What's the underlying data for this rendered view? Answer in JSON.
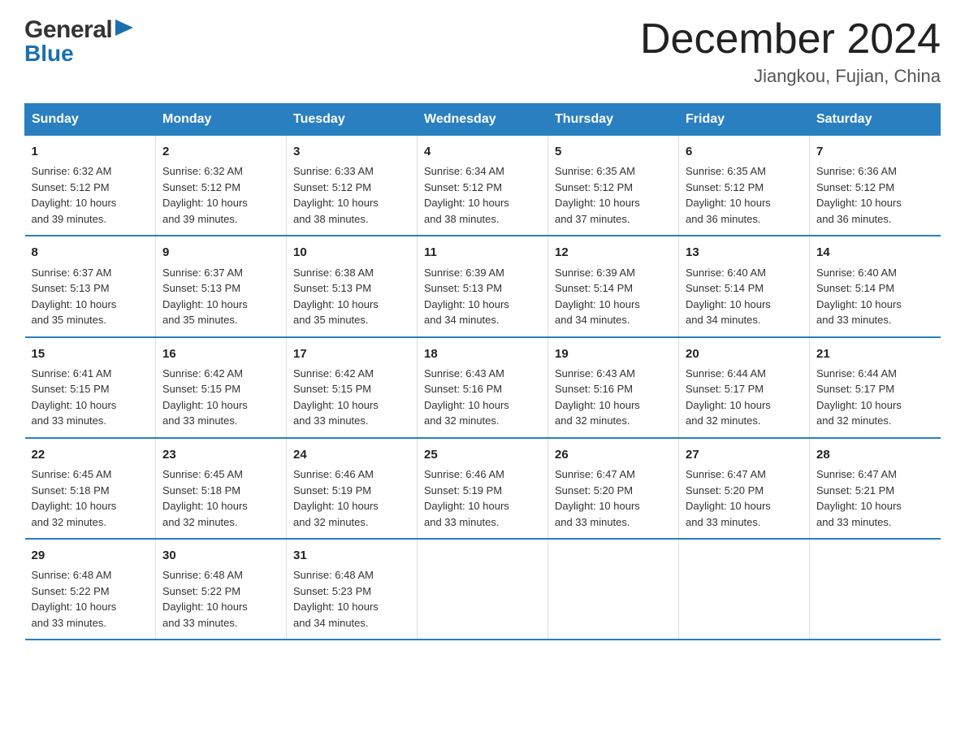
{
  "logo": {
    "general": "General",
    "blue": "Blue"
  },
  "title": "December 2024",
  "subtitle": "Jiangkou, Fujian, China",
  "weekdays": [
    "Sunday",
    "Monday",
    "Tuesday",
    "Wednesday",
    "Thursday",
    "Friday",
    "Saturday"
  ],
  "weeks": [
    [
      {
        "day": "1",
        "info": "Sunrise: 6:32 AM\nSunset: 5:12 PM\nDaylight: 10 hours\nand 39 minutes."
      },
      {
        "day": "2",
        "info": "Sunrise: 6:32 AM\nSunset: 5:12 PM\nDaylight: 10 hours\nand 39 minutes."
      },
      {
        "day": "3",
        "info": "Sunrise: 6:33 AM\nSunset: 5:12 PM\nDaylight: 10 hours\nand 38 minutes."
      },
      {
        "day": "4",
        "info": "Sunrise: 6:34 AM\nSunset: 5:12 PM\nDaylight: 10 hours\nand 38 minutes."
      },
      {
        "day": "5",
        "info": "Sunrise: 6:35 AM\nSunset: 5:12 PM\nDaylight: 10 hours\nand 37 minutes."
      },
      {
        "day": "6",
        "info": "Sunrise: 6:35 AM\nSunset: 5:12 PM\nDaylight: 10 hours\nand 36 minutes."
      },
      {
        "day": "7",
        "info": "Sunrise: 6:36 AM\nSunset: 5:12 PM\nDaylight: 10 hours\nand 36 minutes."
      }
    ],
    [
      {
        "day": "8",
        "info": "Sunrise: 6:37 AM\nSunset: 5:13 PM\nDaylight: 10 hours\nand 35 minutes."
      },
      {
        "day": "9",
        "info": "Sunrise: 6:37 AM\nSunset: 5:13 PM\nDaylight: 10 hours\nand 35 minutes."
      },
      {
        "day": "10",
        "info": "Sunrise: 6:38 AM\nSunset: 5:13 PM\nDaylight: 10 hours\nand 35 minutes."
      },
      {
        "day": "11",
        "info": "Sunrise: 6:39 AM\nSunset: 5:13 PM\nDaylight: 10 hours\nand 34 minutes."
      },
      {
        "day": "12",
        "info": "Sunrise: 6:39 AM\nSunset: 5:14 PM\nDaylight: 10 hours\nand 34 minutes."
      },
      {
        "day": "13",
        "info": "Sunrise: 6:40 AM\nSunset: 5:14 PM\nDaylight: 10 hours\nand 34 minutes."
      },
      {
        "day": "14",
        "info": "Sunrise: 6:40 AM\nSunset: 5:14 PM\nDaylight: 10 hours\nand 33 minutes."
      }
    ],
    [
      {
        "day": "15",
        "info": "Sunrise: 6:41 AM\nSunset: 5:15 PM\nDaylight: 10 hours\nand 33 minutes."
      },
      {
        "day": "16",
        "info": "Sunrise: 6:42 AM\nSunset: 5:15 PM\nDaylight: 10 hours\nand 33 minutes."
      },
      {
        "day": "17",
        "info": "Sunrise: 6:42 AM\nSunset: 5:15 PM\nDaylight: 10 hours\nand 33 minutes."
      },
      {
        "day": "18",
        "info": "Sunrise: 6:43 AM\nSunset: 5:16 PM\nDaylight: 10 hours\nand 32 minutes."
      },
      {
        "day": "19",
        "info": "Sunrise: 6:43 AM\nSunset: 5:16 PM\nDaylight: 10 hours\nand 32 minutes."
      },
      {
        "day": "20",
        "info": "Sunrise: 6:44 AM\nSunset: 5:17 PM\nDaylight: 10 hours\nand 32 minutes."
      },
      {
        "day": "21",
        "info": "Sunrise: 6:44 AM\nSunset: 5:17 PM\nDaylight: 10 hours\nand 32 minutes."
      }
    ],
    [
      {
        "day": "22",
        "info": "Sunrise: 6:45 AM\nSunset: 5:18 PM\nDaylight: 10 hours\nand 32 minutes."
      },
      {
        "day": "23",
        "info": "Sunrise: 6:45 AM\nSunset: 5:18 PM\nDaylight: 10 hours\nand 32 minutes."
      },
      {
        "day": "24",
        "info": "Sunrise: 6:46 AM\nSunset: 5:19 PM\nDaylight: 10 hours\nand 32 minutes."
      },
      {
        "day": "25",
        "info": "Sunrise: 6:46 AM\nSunset: 5:19 PM\nDaylight: 10 hours\nand 33 minutes."
      },
      {
        "day": "26",
        "info": "Sunrise: 6:47 AM\nSunset: 5:20 PM\nDaylight: 10 hours\nand 33 minutes."
      },
      {
        "day": "27",
        "info": "Sunrise: 6:47 AM\nSunset: 5:20 PM\nDaylight: 10 hours\nand 33 minutes."
      },
      {
        "day": "28",
        "info": "Sunrise: 6:47 AM\nSunset: 5:21 PM\nDaylight: 10 hours\nand 33 minutes."
      }
    ],
    [
      {
        "day": "29",
        "info": "Sunrise: 6:48 AM\nSunset: 5:22 PM\nDaylight: 10 hours\nand 33 minutes."
      },
      {
        "day": "30",
        "info": "Sunrise: 6:48 AM\nSunset: 5:22 PM\nDaylight: 10 hours\nand 33 minutes."
      },
      {
        "day": "31",
        "info": "Sunrise: 6:48 AM\nSunset: 5:23 PM\nDaylight: 10 hours\nand 34 minutes."
      },
      {
        "day": "",
        "info": ""
      },
      {
        "day": "",
        "info": ""
      },
      {
        "day": "",
        "info": ""
      },
      {
        "day": "",
        "info": ""
      }
    ]
  ]
}
